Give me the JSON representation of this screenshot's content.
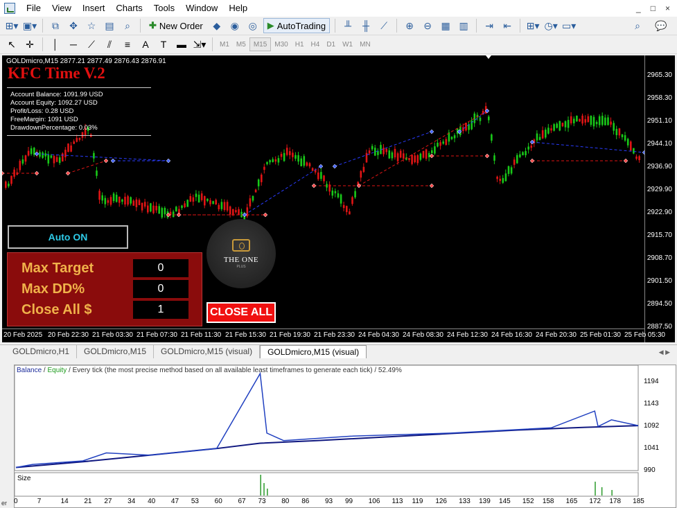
{
  "menu": {
    "items": [
      "File",
      "View",
      "Insert",
      "Charts",
      "Tools",
      "Window",
      "Help"
    ],
    "controls": [
      "_",
      "□",
      "×"
    ]
  },
  "toolbar": {
    "new_order": "New Order",
    "auto_trading": "AutoTrading",
    "timeframes": [
      "M1",
      "M5",
      "M15",
      "M30",
      "H1",
      "H4",
      "D1",
      "W1",
      "MN"
    ],
    "active_timeframe": "M15"
  },
  "chart": {
    "symbol_info": "GOLDmicro,M15  2877.21 2877.49 2876.43 2876.91",
    "ea_title": "KFC Time V.2",
    "account": [
      "Account Balance: 1091.99 USD",
      "Account Equity: 1092.27 USD",
      "Profit/Loss: 0.28 USD",
      "FreeMargin: 1091 USD",
      "DrawdownPercentage: 0.03%"
    ],
    "price_scale": [
      "2965.30",
      "2958.30",
      "2951.10",
      "2944.10",
      "2936.90",
      "2929.90",
      "2922.90",
      "2915.70",
      "2908.70",
      "2901.50",
      "2894.50",
      "2887.50"
    ],
    "time_axis": [
      "20 Feb 2025",
      "20 Feb 22:30",
      "21 Feb 03:30",
      "21 Feb 07:30",
      "21 Feb 11:30",
      "21 Feb 15:30",
      "21 Feb 19:30",
      "21 Feb 23:30",
      "24 Feb 04:30",
      "24 Feb 08:30",
      "24 Feb 12:30",
      "24 Feb 16:30",
      "24 Feb 20:30",
      "25 Feb 01:30",
      "25 Feb 05:30"
    ],
    "colors": {
      "bull": "#19c919",
      "bear": "#e01515",
      "buy_line": "#2a3cff",
      "sell_line": "#e01515"
    }
  },
  "panel": {
    "auto_label": "Auto ON",
    "rows": [
      {
        "label": "Max Target",
        "value": "0"
      },
      {
        "label": "Max DD%",
        "value": "0"
      },
      {
        "label": "Close All $",
        "value": "1"
      }
    ],
    "close_all": "CLOSE ALL",
    "logo_text": "THE ONE",
    "logo_sub": "PLUS"
  },
  "tabs": [
    "GOLDmicro,H1",
    "GOLDmicro,M15",
    "GOLDmicro,M15 (visual)",
    "GOLDmicro,M15 (visual)"
  ],
  "active_tab": 3,
  "graph": {
    "legend_balance": "Balance",
    "legend_equity": "Equity",
    "header_rest": " / Every tick (the most precise method based on all available least timeframes to generate each tick) / 52.49%",
    "y_labels": [
      "1194",
      "1143",
      "1092",
      "1041",
      "990"
    ],
    "size_label": "Size",
    "x_ticks": [
      "0",
      "7",
      "14",
      "21",
      "27",
      "34",
      "40",
      "47",
      "53",
      "60",
      "67",
      "73",
      "80",
      "86",
      "93",
      "99",
      "106",
      "113",
      "119",
      "126",
      "133",
      "139",
      "145",
      "152",
      "158",
      "165",
      "172",
      "178",
      "185"
    ],
    "side_label": "er"
  },
  "chart_data": {
    "type": "line",
    "title": "",
    "series": [
      {
        "name": "Balance",
        "x": [
          0,
          20,
          40,
          60,
          73,
          90,
          110,
          130,
          150,
          170,
          186
        ],
        "y": [
          997,
          1010,
          1025,
          1040,
          1052,
          1058,
          1066,
          1074,
          1082,
          1088,
          1092
        ]
      },
      {
        "name": "Equity",
        "x": [
          0,
          5,
          20,
          27,
          40,
          60,
          73,
          75,
          80,
          100,
          130,
          160,
          173,
          174,
          178,
          186
        ],
        "y": [
          997,
          1004,
          1012,
          1030,
          1025,
          1040,
          1210,
          1075,
          1058,
          1068,
          1075,
          1087,
          1125,
          1090,
          1105,
          1092
        ]
      }
    ],
    "ylim": [
      990,
      1210
    ],
    "xlim": [
      0,
      186
    ]
  }
}
